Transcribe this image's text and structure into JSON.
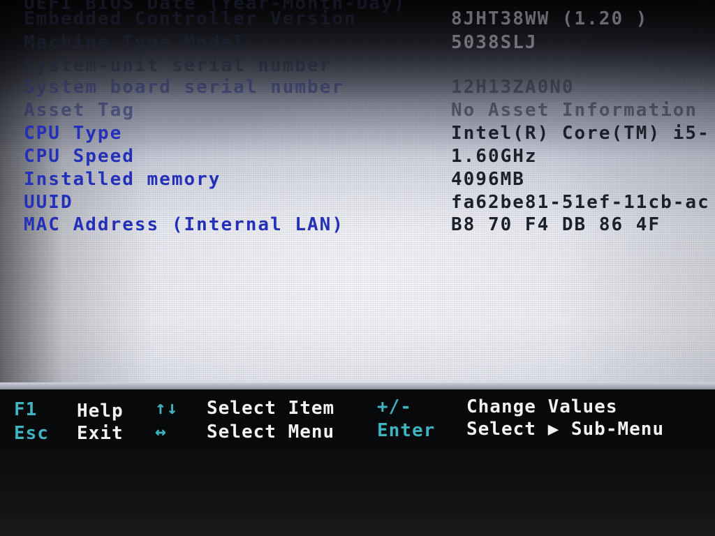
{
  "system_info": [
    {
      "label": "UEFI BIOS Date (Year-Month-Day)",
      "value": ""
    },
    {
      "label": "Embedded Controller Version",
      "value": "8JHT38WW (1.20 )"
    },
    {
      "label": "Machine Type Model",
      "value": "5038SLJ"
    },
    {
      "label": "System-unit serial number",
      "value": ""
    },
    {
      "label": "System board serial number",
      "value": "12H13ZA0N0"
    },
    {
      "label": "Asset Tag",
      "value": "No Asset Information"
    },
    {
      "label": "CPU Type",
      "value": "Intel(R) Core(TM) i5-"
    },
    {
      "label": "CPU Speed",
      "value": "1.60GHz"
    },
    {
      "label": "Installed memory",
      "value": "4096MB"
    },
    {
      "label": "UUID",
      "value": "fa62be81-51ef-11cb-ac"
    },
    {
      "label": "MAC Address (Internal LAN)",
      "value": "B8 70 F4 DB 86 4F"
    }
  ],
  "help_bar": {
    "f1_key": "F1",
    "f1_text": "Help",
    "esc_key": "Esc",
    "esc_text": "Exit",
    "updown_key": "↑↓",
    "updown_text": "Select Item",
    "leftright_key": "↔",
    "leftright_text": "Select Menu",
    "plusminus_key": "+/-",
    "plusminus_text": "Change Values",
    "enter_key": "Enter",
    "enter_text": "Select ▶ Sub-Menu"
  },
  "colors": {
    "label_blue": "#2430b8",
    "value_dark": "#1d1f2a",
    "hotkey_cyan": "#3fb3c0",
    "help_text_white": "#f2f2f2"
  }
}
